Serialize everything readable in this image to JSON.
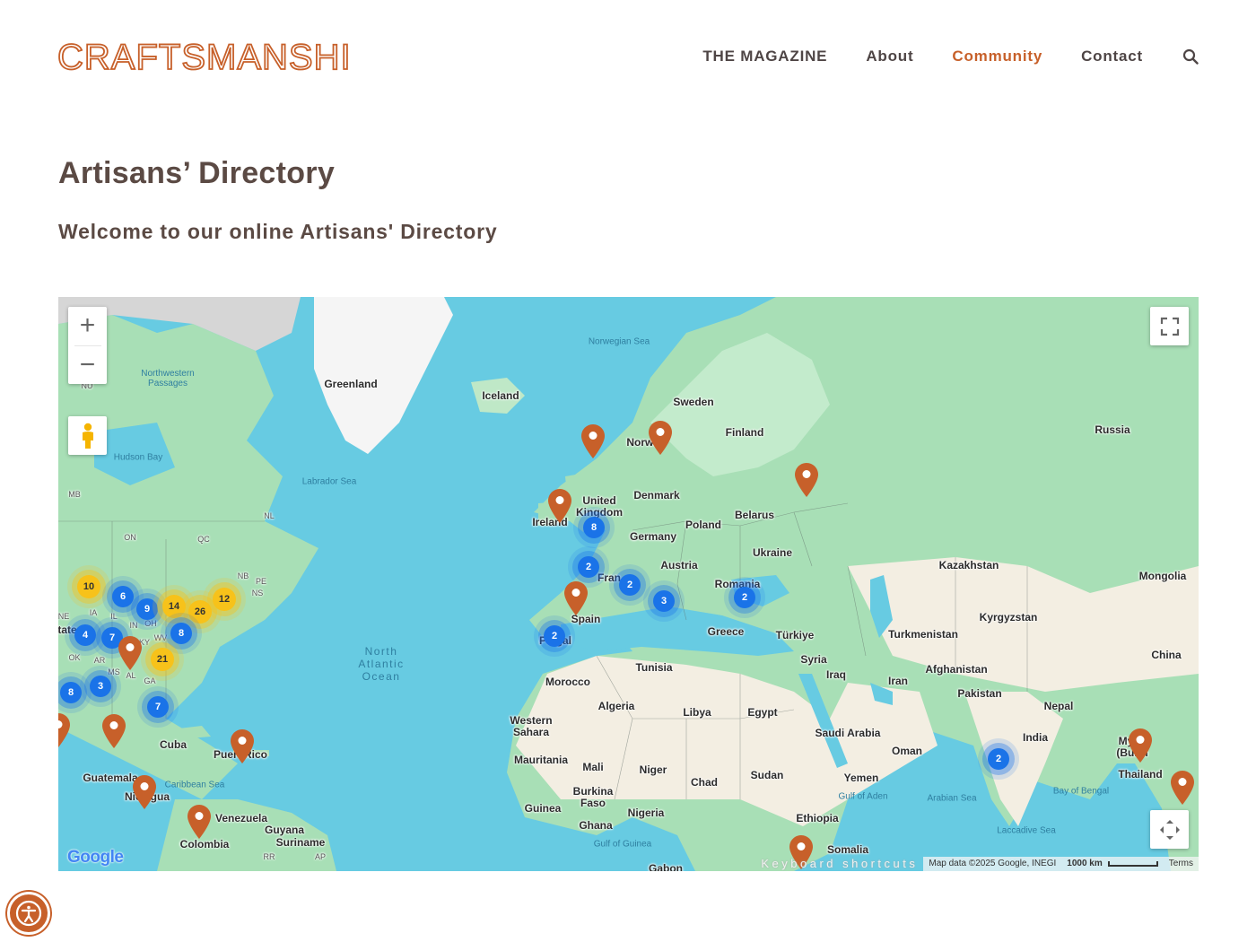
{
  "brand": {
    "logo_text": "CRAFTSMANSHIP",
    "accent_color": "#c7602a"
  },
  "nav": {
    "items": [
      {
        "label": "THE MAGAZINE",
        "active": false
      },
      {
        "label": "About",
        "active": false
      },
      {
        "label": "Community",
        "active": true
      },
      {
        "label": "Contact",
        "active": false
      }
    ],
    "search_icon": "search-icon"
  },
  "page": {
    "title": "Artisans’ Directory",
    "subtitle": "Welcome to our online Artisans' Directory"
  },
  "map": {
    "controls": {
      "zoom_in": "+",
      "zoom_out": "−"
    },
    "labels": {
      "greenland": "Greenland",
      "iceland": "Iceland",
      "norwegian_sea": "Norwegian Sea",
      "sweden": "Sweden",
      "finland": "Finland",
      "norway": "Norway",
      "russia": "Russia",
      "denmark": "Denmark",
      "united_kingdom": "United Kingdom",
      "ireland": "Ireland",
      "belarus": "Belarus",
      "poland": "Poland",
      "germany": "Germany",
      "ukraine": "Ukraine",
      "austria": "Austria",
      "france": "Fran",
      "romania": "Romania",
      "kazakhstan": "Kazakhstan",
      "mongolia": "Mongolia",
      "spain": "Spain",
      "portugal": "Po gal",
      "greece": "Greece",
      "turkiye": "Türkiye",
      "kyrgyzstan": "Kyrgyzstan",
      "turkmenistan": "Turkmenistan",
      "tunisia": "Tunisia",
      "syria": "Syria",
      "iraq": "Iraq",
      "iran": "Iran",
      "afghanistan": "Afghanistan",
      "china": "China",
      "pakistan": "Pakistan",
      "nepal": "Nepal",
      "morocco": "Morocco",
      "algeria": "Algeria",
      "libya": "Libya",
      "egypt": "Egypt",
      "western_sahara": "Western Sahara",
      "saudi_arabia": "Saudi Arabia",
      "oman": "Oman",
      "india": "India",
      "myanmar": "Myan (Burm",
      "mauritania": "Mauritania",
      "mali": "Mali",
      "niger": "Niger",
      "chad": "Chad",
      "sudan": "Sudan",
      "yemen": "Yemen",
      "thailand": "Thailand",
      "burkina_faso": "Burkina Faso",
      "guinea": "Guinea",
      "nigeria": "Nigeria",
      "ghana": "Ghana",
      "ethiopia": "Ethiopia",
      "somalia": "Somalia",
      "gabon": "Gabon",
      "gulf_of_guinea": "Gulf of Guinea",
      "gulf_of_aden": "Gulf of Aden",
      "arabian_sea": "Arabian Sea",
      "bay_of_bengal": "Bay of Bengal",
      "laccadive_sea": "Laccadive Sea",
      "north_atlantic_ocean": "North\nAtlantic\nOcean",
      "labrador_sea": "Labrador Sea",
      "hudson_bay": "Hudson Bay",
      "northwestern_passages": "Northwestern Passages",
      "cuba": "Cuba",
      "puerto_rico": "Puert Rico",
      "caribbean_sea": "Caribbean Sea",
      "guatemala": "Guatemala",
      "nicaragua": "Nic agua",
      "venezuela": "Venezuela",
      "guyana": "Guyana",
      "suriname": "Suriname",
      "colombia": "Colombia",
      "nu": "NU",
      "mb": "MB",
      "on": "ON",
      "qc": "QC",
      "nl": "NL",
      "nb": "NB",
      "pe": "PE",
      "ns": "NS",
      "ia": "IA",
      "il": "IL",
      "in": "IN",
      "oh": "OH",
      "ok": "OK",
      "ar": "AR",
      "ms": "MS",
      "al": "AL",
      "ga": "GA",
      "ky": "KY",
      "wv": "WV",
      "ne": "NE",
      "state": "tate",
      "rr": "RR",
      "ap": "AP"
    },
    "clusters": [
      {
        "count": "10",
        "color": "yellow"
      },
      {
        "count": "6",
        "color": "blue"
      },
      {
        "count": "9",
        "color": "blue"
      },
      {
        "count": "14",
        "color": "yellow"
      },
      {
        "count": "26",
        "color": "yellow"
      },
      {
        "count": "12",
        "color": "yellow"
      },
      {
        "count": "4",
        "color": "blue"
      },
      {
        "count": "7",
        "color": "blue"
      },
      {
        "count": "8",
        "color": "blue"
      },
      {
        "count": "21",
        "color": "yellow"
      },
      {
        "count": "8",
        "color": "blue"
      },
      {
        "count": "3",
        "color": "blue"
      },
      {
        "count": "7",
        "color": "blue"
      },
      {
        "count": "8",
        "color": "blue"
      },
      {
        "count": "2",
        "color": "blue"
      },
      {
        "count": "2",
        "color": "blue"
      },
      {
        "count": "3",
        "color": "blue"
      },
      {
        "count": "2",
        "color": "blue"
      },
      {
        "count": "2",
        "color": "blue"
      },
      {
        "count": "2",
        "color": "blue"
      }
    ],
    "google_logo": "Google",
    "attribution": {
      "keyboard_shortcuts": "Keyboard shortcuts",
      "map_data": "Map data ©2025 Google, INEGI",
      "scale": "1000 km",
      "terms": "Terms"
    }
  },
  "accessibility_button": "accessibility-icon"
}
